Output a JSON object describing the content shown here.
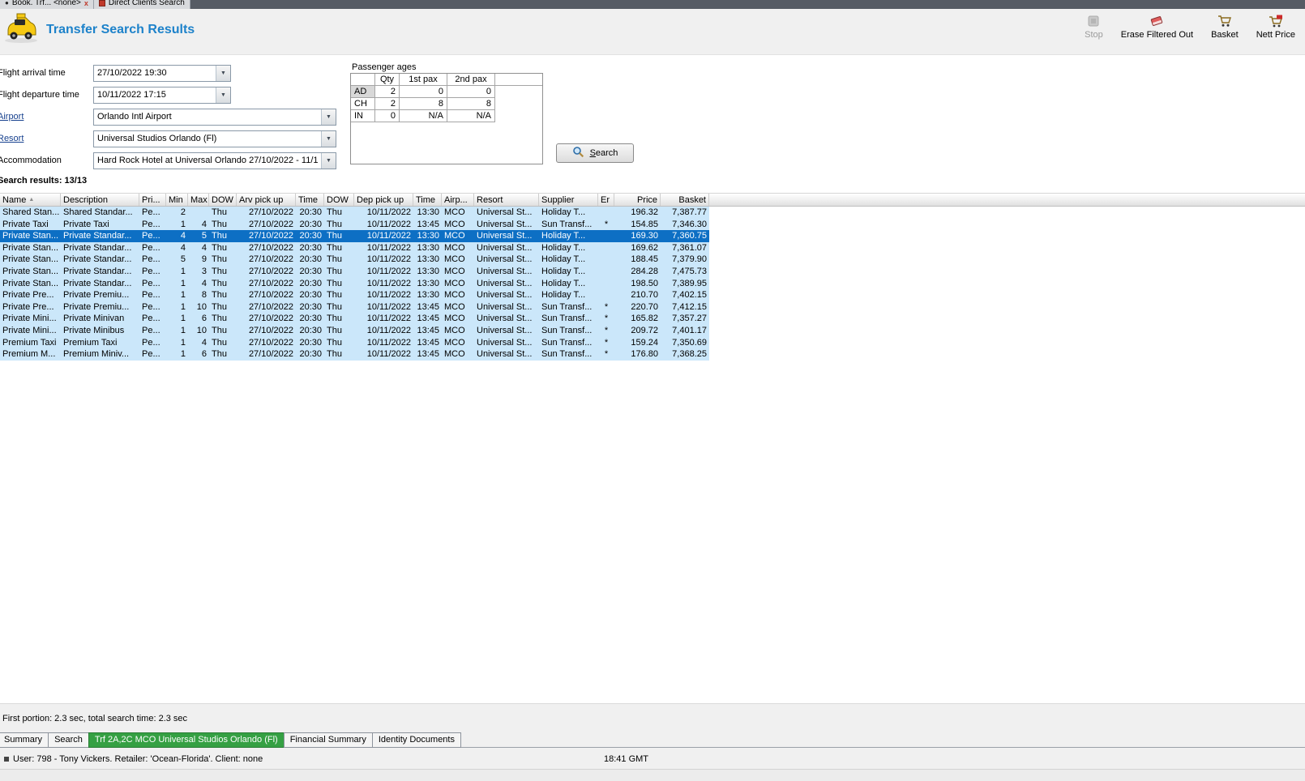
{
  "colors": {
    "title_blue": "#1d82ca",
    "row_blue": "#cbe7fa",
    "selected_blue": "#0d6fc4",
    "active_tab_green": "#35a043"
  },
  "window_tabs": {
    "tab1": {
      "label": "Book. Trf... <none>"
    },
    "tab2": {
      "label": "Direct Clients Search"
    }
  },
  "header": {
    "title": "Transfer Search Results",
    "toolbar": [
      {
        "id": "stop",
        "label": "Stop",
        "icon": "stop-icon",
        "disabled": true
      },
      {
        "id": "erase-filtered-out",
        "label": "Erase Filtered Out",
        "icon": "eraser-icon",
        "disabled": false
      },
      {
        "id": "basket",
        "label": "Basket",
        "icon": "basket-icon",
        "disabled": false
      },
      {
        "id": "nett-price",
        "label": "Nett Price",
        "icon": "nett-price-icon",
        "disabled": false
      }
    ]
  },
  "form": {
    "fields": [
      {
        "id": "flight-arrival-time",
        "label": "Flight arrival time",
        "value": "27/10/2022 19:30",
        "link": false
      },
      {
        "id": "flight-departure-time",
        "label": "Flight departure time",
        "value": "10/11/2022 17:15",
        "link": false
      },
      {
        "id": "airport",
        "label": "Airport",
        "value": "Orlando Intl Airport",
        "link": true
      },
      {
        "id": "resort",
        "label": "Resort",
        "value": "Universal Studios Orlando (Fl)",
        "link": true
      },
      {
        "id": "accommodation",
        "label": "Accommodation",
        "value": "Hard Rock Hotel at Universal Orlando 27/10/2022 - 11/1",
        "link": false
      }
    ]
  },
  "passenger_ages": {
    "title": "Passenger ages",
    "columns": [
      "",
      "Qty",
      "1st pax",
      "2nd pax"
    ],
    "rows": [
      [
        "AD",
        "2",
        "0",
        "0"
      ],
      [
        "CH",
        "2",
        "8",
        "8"
      ],
      [
        "IN",
        "0",
        "N/A",
        "N/A"
      ]
    ]
  },
  "search_button": {
    "label": "Search"
  },
  "results": {
    "summary": "Search results: 13/13",
    "columns": [
      "Name",
      "Description",
      "Pri...",
      "Min",
      "Max",
      "DOW",
      "Arv pick up",
      "Time",
      "DOW",
      "Dep pick up",
      "Time",
      "Airp...",
      "Resort",
      "Supplier",
      "Er",
      "Price",
      "Basket"
    ],
    "selected_index": 2,
    "rows": [
      [
        "Shared Stan...",
        "Shared Standar...",
        "Pe...",
        "2",
        "",
        "Thu",
        "27/10/2022",
        "20:30",
        "Thu",
        "10/11/2022",
        "13:30",
        "MCO",
        "Universal St...",
        "Holiday T...",
        "",
        "196.32",
        "7,387.77"
      ],
      [
        "Private Taxi",
        "Private Taxi",
        "Pe...",
        "1",
        "4",
        "Thu",
        "27/10/2022",
        "20:30",
        "Thu",
        "10/11/2022",
        "13:45",
        "MCO",
        "Universal St...",
        "Sun Transf...",
        "*",
        "154.85",
        "7,346.30"
      ],
      [
        "Private Stan...",
        "Private Standar...",
        "Pe...",
        "4",
        "5",
        "Thu",
        "27/10/2022",
        "20:30",
        "Thu",
        "10/11/2022",
        "13:30",
        "MCO",
        "Universal St...",
        "Holiday T...",
        "",
        "169.30",
        "7,360.75"
      ],
      [
        "Private Stan...",
        "Private Standar...",
        "Pe...",
        "4",
        "4",
        "Thu",
        "27/10/2022",
        "20:30",
        "Thu",
        "10/11/2022",
        "13:30",
        "MCO",
        "Universal St...",
        "Holiday T...",
        "",
        "169.62",
        "7,361.07"
      ],
      [
        "Private Stan...",
        "Private Standar...",
        "Pe...",
        "5",
        "9",
        "Thu",
        "27/10/2022",
        "20:30",
        "Thu",
        "10/11/2022",
        "13:30",
        "MCO",
        "Universal St...",
        "Holiday T...",
        "",
        "188.45",
        "7,379.90"
      ],
      [
        "Private Stan...",
        "Private Standar...",
        "Pe...",
        "1",
        "3",
        "Thu",
        "27/10/2022",
        "20:30",
        "Thu",
        "10/11/2022",
        "13:30",
        "MCO",
        "Universal St...",
        "Holiday T...",
        "",
        "284.28",
        "7,475.73"
      ],
      [
        "Private Stan...",
        "Private Standar...",
        "Pe...",
        "1",
        "4",
        "Thu",
        "27/10/2022",
        "20:30",
        "Thu",
        "10/11/2022",
        "13:30",
        "MCO",
        "Universal St...",
        "Holiday T...",
        "",
        "198.50",
        "7,389.95"
      ],
      [
        "Private Pre...",
        "Private Premiu...",
        "Pe...",
        "1",
        "8",
        "Thu",
        "27/10/2022",
        "20:30",
        "Thu",
        "10/11/2022",
        "13:30",
        "MCO",
        "Universal St...",
        "Holiday T...",
        "",
        "210.70",
        "7,402.15"
      ],
      [
        "Private Pre...",
        "Private Premiu...",
        "Pe...",
        "1",
        "10",
        "Thu",
        "27/10/2022",
        "20:30",
        "Thu",
        "10/11/2022",
        "13:45",
        "MCO",
        "Universal St...",
        "Sun Transf...",
        "*",
        "220.70",
        "7,412.15"
      ],
      [
        "Private Mini...",
        "Private Minivan",
        "Pe...",
        "1",
        "6",
        "Thu",
        "27/10/2022",
        "20:30",
        "Thu",
        "10/11/2022",
        "13:45",
        "MCO",
        "Universal St...",
        "Sun Transf...",
        "*",
        "165.82",
        "7,357.27"
      ],
      [
        "Private Mini...",
        "Private Minibus",
        "Pe...",
        "1",
        "10",
        "Thu",
        "27/10/2022",
        "20:30",
        "Thu",
        "10/11/2022",
        "13:45",
        "MCO",
        "Universal St...",
        "Sun Transf...",
        "*",
        "209.72",
        "7,401.17"
      ],
      [
        "Premium Taxi",
        "Premium Taxi",
        "Pe...",
        "1",
        "4",
        "Thu",
        "27/10/2022",
        "20:30",
        "Thu",
        "10/11/2022",
        "13:45",
        "MCO",
        "Universal St...",
        "Sun Transf...",
        "*",
        "159.24",
        "7,350.69"
      ],
      [
        "Premium M...",
        "Premium Miniv...",
        "Pe...",
        "1",
        "6",
        "Thu",
        "27/10/2022",
        "20:30",
        "Thu",
        "10/11/2022",
        "13:45",
        "MCO",
        "Universal St...",
        "Sun Transf...",
        "*",
        "176.80",
        "7,368.25"
      ]
    ]
  },
  "footer": {
    "search_time": "First portion: 2.3 sec, total search time: 2.3 sec",
    "tabs": [
      "Summary",
      "Search",
      "Trf 2A,2C MCO Universal Studios Orlando (Fl)",
      "Financial Summary",
      "Identity Documents"
    ],
    "active_index": 2,
    "user_info": "User: 798 - Tony Vickers.  Retailer: 'Ocean-Florida'.  Client: none",
    "time": "18:41 GMT"
  }
}
